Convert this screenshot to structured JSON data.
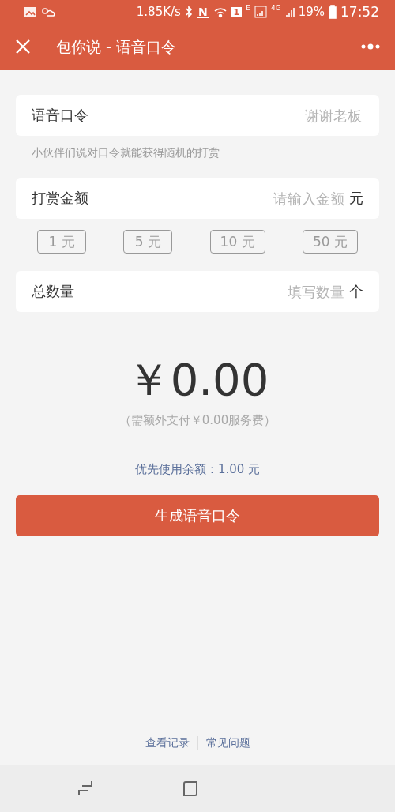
{
  "status_bar": {
    "net_speed": "1.85K/s",
    "nfc": "N",
    "sim_slot": "1",
    "network_1": "E",
    "network_2": "4G",
    "battery": "19%",
    "time": "17:52"
  },
  "header": {
    "title": "包你说 - 语音口令"
  },
  "fields": [
    {
      "label": "语音口令",
      "placeholder": "谢谢老板"
    },
    {
      "label": "打赏金额",
      "placeholder": "请输入金额",
      "unit": "元"
    },
    {
      "label": "总数量",
      "placeholder": "填写数量",
      "unit": "个"
    }
  ],
  "hint": "小伙伴们说对口令就能获得随机的打赏",
  "amount_chips": [
    "1 元",
    "5 元",
    "10 元",
    "50 元"
  ],
  "total": "￥0.00",
  "fee_note": "（需额外支付￥0.00服务费）",
  "balance_note": "优先使用余额：1.00 元",
  "submit_button": "生成语音口令",
  "footer_links": [
    "查看记录",
    "常见问题"
  ]
}
